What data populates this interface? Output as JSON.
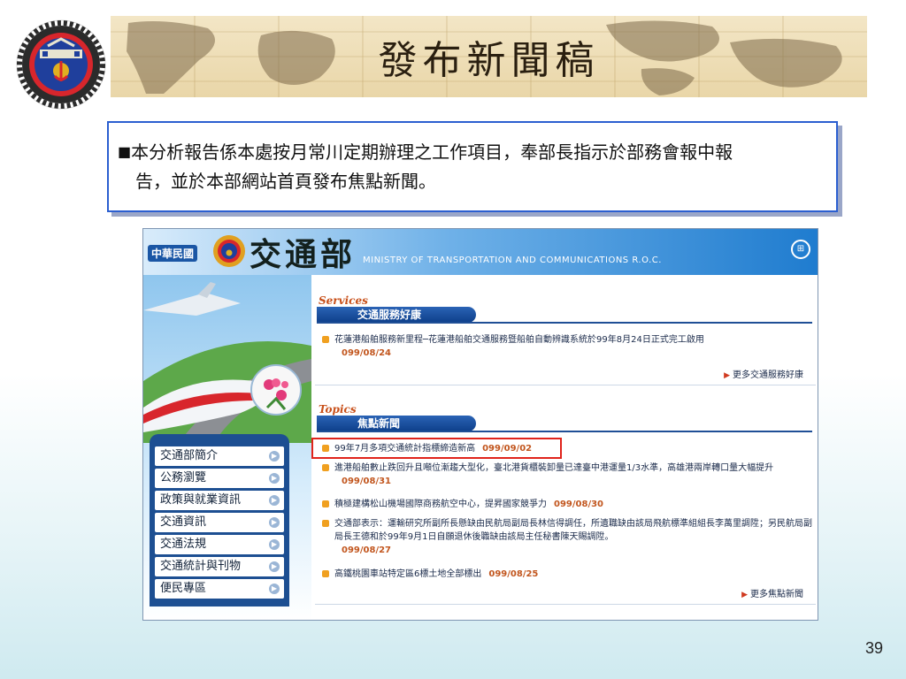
{
  "slide": {
    "title": "發布新聞稿",
    "page_number": "39"
  },
  "note": {
    "bullet": "■",
    "line1": "本分析報告係本處按月常川定期辦理之工作項目，奉部長指示於部務會報中報",
    "line2": "告，並於本部網站首頁發布焦點新聞。"
  },
  "site": {
    "roc_tag": "中華民國",
    "name": "交通部",
    "english": "MINISTRY OF TRANSPORTATION AND COMMUNICATIONS  R.O.C.",
    "menu": [
      "交通部簡介",
      "公務瀏覽",
      "政策與就業資訊",
      "交通資訊",
      "交通法規",
      "交通統計與刊物",
      "便民專區"
    ],
    "services": {
      "en": "Services",
      "title": "交通服務好康",
      "items": [
        {
          "text": "花蓮港船舶服務新里程─花蓮港船舶交通服務暨船舶自動辨識系統於99年8月24日正式完工啟用",
          "date": "099/08/24"
        }
      ],
      "more": "更多交通服務好康"
    },
    "topics": {
      "en": "Topics",
      "title": "焦點新聞",
      "items": [
        {
          "text": "99年7月多項交通統計指標締造新高",
          "date": "099/09/02"
        },
        {
          "text": "進港船舶數止跌回升且噸位漸趨大型化，臺北港貨櫃裝卸量已達臺中港運量1/3水準，高雄港兩岸轉口量大幅提升",
          "date": "099/08/31"
        },
        {
          "text": "積極建構松山機場國際商務航空中心，提昇國家競爭力",
          "date": "099/08/30"
        },
        {
          "text": "交通部表示：運輸研究所副所長懸缺由民航局副局長林信得調任，所遺職缺由該局飛航標準組組長李萬里調陞；另民航局副局長王德和於99年9月1日自願退休後職缺由該局主任秘書陳天賜調陞。",
          "date": "099/08/27"
        },
        {
          "text": "高鐵桃園車站特定區6標土地全部標出",
          "date": "099/08/25"
        }
      ],
      "more": "更多焦點新聞"
    }
  }
}
